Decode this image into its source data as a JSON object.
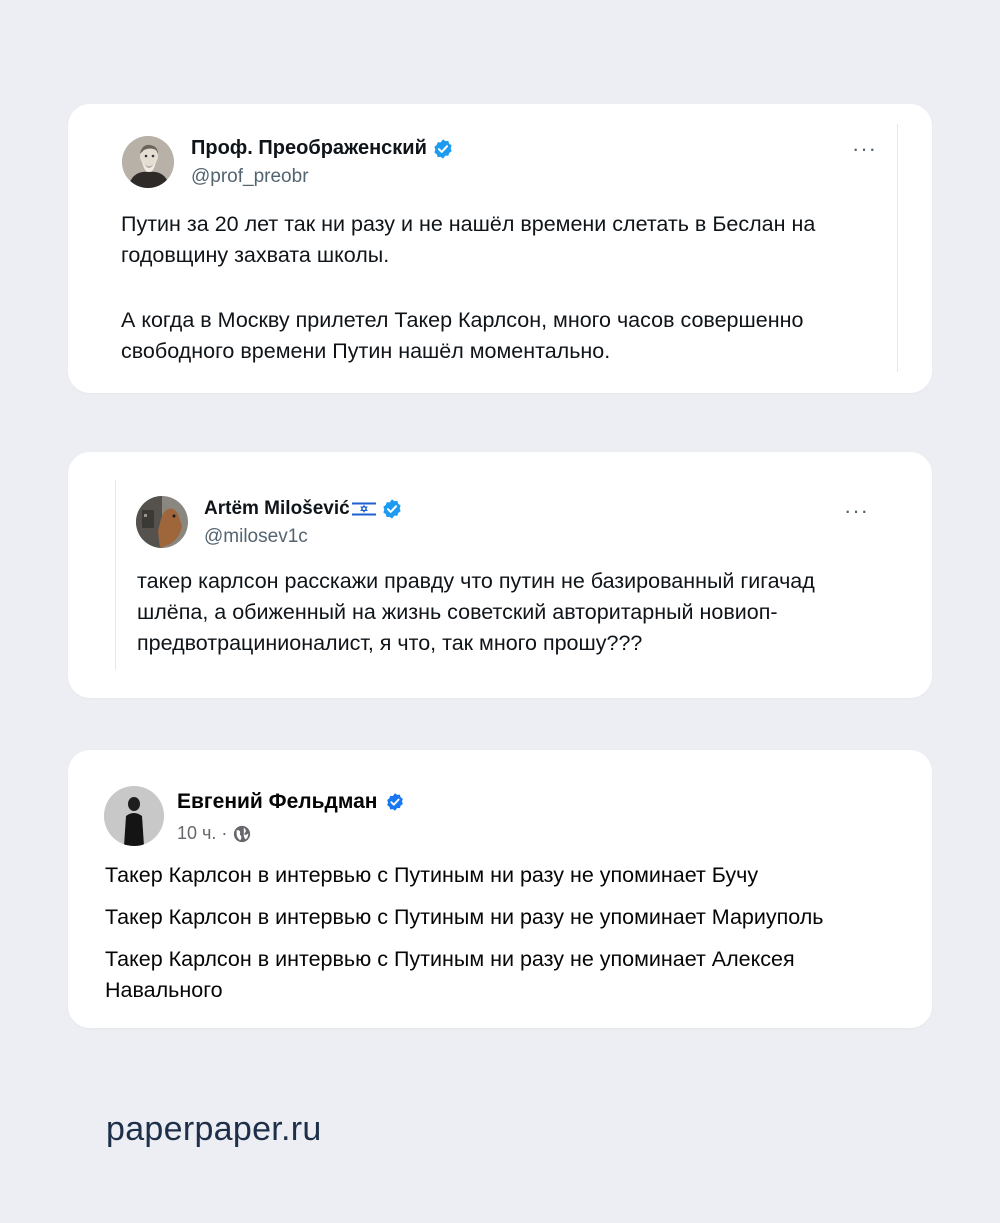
{
  "posts": [
    {
      "name": "Проф. Преображенский",
      "handle": "@prof_preobr",
      "paragraphs": [
        "Путин за 20 лет так ни разу и не нашёл времени слетать в Беслан на годовщину захвата школы.",
        "А когда в Москву прилетел Такер Карлсон, много часов совершенно свободного времени Путин нашёл моментально."
      ]
    },
    {
      "name": "Artëm Milošević",
      "handle": "@milosev1c",
      "text": "такер карлсон расскажи правду что путин не базированный гигачад шлёпа, а обиженный на жизнь советский авторитарный новиоп-предвотрацинионалист, я что, так много прошу???"
    },
    {
      "name": "Евгений Фельдман",
      "time": "10 ч. ·",
      "lines": [
        "Такер Карлсон в интервью с Путиным ни разу не упоминает Бучу",
        "Такер Карлсон в интервью с Путиным ни разу не упоминает Мариуполь",
        "Такер Карлсон в интервью с Путиным ни разу не упоминает Алексея Навального"
      ]
    }
  ],
  "more_label": "···",
  "footer": "paperpaper.ru",
  "colors": {
    "verified": "#1d9bf0",
    "fb_verified": "#1877f2",
    "background": "#eceef3"
  }
}
